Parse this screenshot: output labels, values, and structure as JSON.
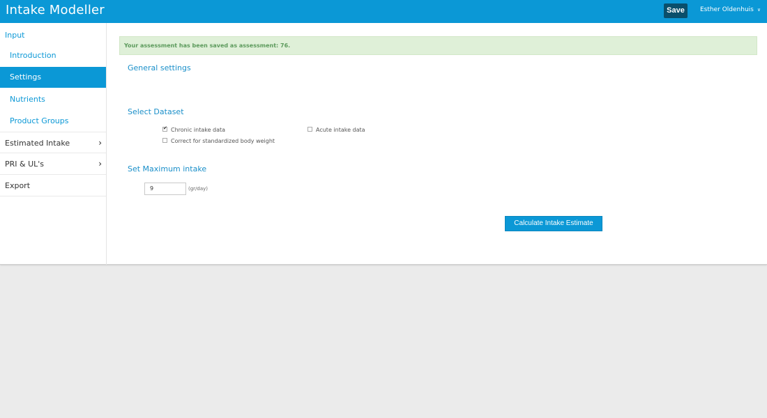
{
  "header": {
    "app_title": "Intake Modeller",
    "save_label": "Save",
    "user_name": "Esther Oldenhuis",
    "user_menu_icon": "chevron-down-icon"
  },
  "sidebar": {
    "input_label": "Input",
    "items": [
      {
        "label": "Introduction"
      },
      {
        "label": "Settings",
        "active": true
      },
      {
        "label": "Nutrients"
      },
      {
        "label": "Product Groups"
      }
    ],
    "sections": [
      {
        "label": "Estimated Intake",
        "icon": "chevron-right-icon"
      },
      {
        "label": "PRI & UL's",
        "icon": "chevron-right-icon"
      },
      {
        "label": "Export"
      }
    ]
  },
  "main": {
    "alert_text": "Your assessment has been saved as assessment: 76.",
    "general_settings_title": "General settings",
    "select_dataset_title": "Select Dataset",
    "options": {
      "chronic": {
        "label": "Chronic intake data",
        "checked": true
      },
      "acute": {
        "label": "Acute intake data",
        "checked": false
      },
      "correct_bw": {
        "label": "Correct for standardized body weight",
        "checked": false
      }
    },
    "set_max_title": "Set Maximum intake",
    "max_intake_value": "9",
    "max_intake_unit": "(gr/day)",
    "calculate_label": "Calculate Intake Estimate"
  },
  "colors": {
    "brand": "#0b98d6",
    "save_button": "#0a4f6b",
    "alert_bg": "#dff0d8",
    "alert_text": "#5c9a5c"
  }
}
